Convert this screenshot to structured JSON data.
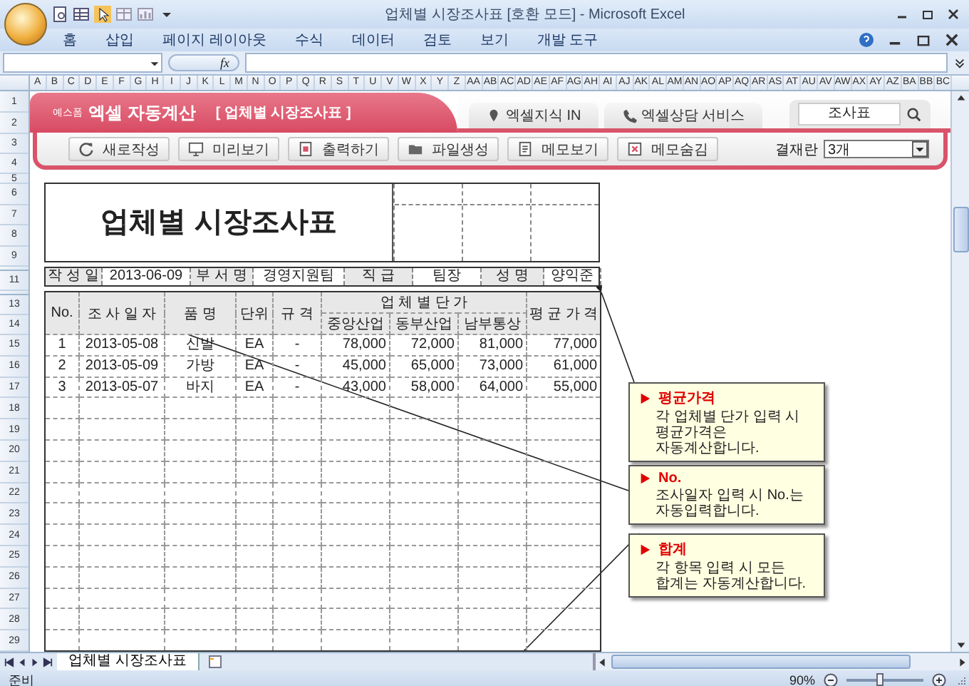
{
  "window": {
    "title": "업체별 시장조사표  [호환 모드] - Microsoft Excel"
  },
  "ribbon_tabs": [
    "홈",
    "삽입",
    "페이지 레이아웃",
    "수식",
    "데이터",
    "검토",
    "보기",
    "개발 도구"
  ],
  "formula_bar": {
    "fx_label": "fx"
  },
  "column_headers": [
    "A",
    "B",
    "C",
    "D",
    "E",
    "F",
    "G",
    "H",
    "I",
    "J",
    "K",
    "L",
    "M",
    "N",
    "O",
    "P",
    "Q",
    "R",
    "S",
    "T",
    "U",
    "V",
    "W",
    "X",
    "Y",
    "Z",
    "AA",
    "AB",
    "AC",
    "AD",
    "AE",
    "AF",
    "AG",
    "AH",
    "AI",
    "AJ",
    "AK",
    "AL",
    "AM",
    "AN",
    "AO",
    "AP",
    "AQ",
    "AR",
    "AS",
    "AT",
    "AU",
    "AV",
    "AW",
    "AX",
    "AY",
    "AZ",
    "BA",
    "BB",
    "BC"
  ],
  "row_headers": [
    "1",
    "2",
    "3",
    "4",
    "5",
    "6",
    "7",
    "8",
    "9",
    "11",
    "13",
    "14",
    "15",
    "16",
    "17",
    "18",
    "19",
    "20",
    "21",
    "22",
    "23",
    "24",
    "25",
    "26",
    "27",
    "28",
    "29"
  ],
  "banner": {
    "brand_prefix": "예스폼",
    "brand": "엑셀 자동계산",
    "form_name": "[ 업체별 시장조사표 ]",
    "links": [
      "엑셀지식 IN",
      "엑셀상담 서비스"
    ],
    "search": "조사표"
  },
  "toolbar": {
    "buttons": [
      {
        "label": "새로작성",
        "kind": "new"
      },
      {
        "label": "미리보기",
        "kind": "preview"
      },
      {
        "label": "출력하기",
        "kind": "print"
      },
      {
        "label": "파일생성",
        "kind": "file"
      },
      {
        "label": "메모보기",
        "kind": "memo_show"
      },
      {
        "label": "메모숨김",
        "kind": "memo_hide"
      }
    ],
    "approval_label": "결재란",
    "approval_value": "3개"
  },
  "sheet": {
    "title": "업체별 시장조사표",
    "info": [
      {
        "label": "작 성 일",
        "value": "2013-06-09"
      },
      {
        "label": "부 서 명",
        "value": "경영지원팀"
      },
      {
        "label": "직  급",
        "value": "팀장"
      },
      {
        "label": "성  명",
        "value": "양익준"
      }
    ],
    "columns": [
      "No.",
      "조 사 일 자",
      "품    명",
      "단위",
      "규  격"
    ],
    "price_group": "업  체  별    단  가",
    "vendors": [
      "중앙산업",
      "동부산업",
      "남부통상"
    ],
    "average": "평 균 가 격",
    "rows": [
      {
        "no": "1",
        "date": "2013-05-08",
        "item": "신발",
        "unit": "EA",
        "spec": "-",
        "prices": [
          "78,000",
          "72,000",
          "81,000"
        ],
        "average": "77,000"
      },
      {
        "no": "2",
        "date": "2013-05-09",
        "item": "가방",
        "unit": "EA",
        "spec": "-",
        "prices": [
          "45,000",
          "65,000",
          "73,000"
        ],
        "average": "61,000"
      },
      {
        "no": "3",
        "date": "2013-05-07",
        "item": "바지",
        "unit": "EA",
        "spec": "-",
        "prices": [
          "43,000",
          "58,000",
          "64,000"
        ],
        "average": "55,000"
      }
    ]
  },
  "notes": [
    {
      "title": "평균가격",
      "lines": [
        "각 업체별 단가 입력 시",
        "평균가격은",
        "자동계산합니다."
      ]
    },
    {
      "title": "No.",
      "lines": [
        "조사일자 입력 시 No.는",
        "자동입력합니다."
      ]
    },
    {
      "title": "합계",
      "lines": [
        "각 항목 입력 시 모든",
        "합계는 자동계산합니다."
      ]
    }
  ],
  "sheet_tabs": [
    {
      "label": "업체별 시장조사표",
      "selected": true
    }
  ],
  "status_bar": {
    "status": "준비",
    "zoom": "90%",
    "zoom_slider": {
      "level": 0.45
    }
  }
}
